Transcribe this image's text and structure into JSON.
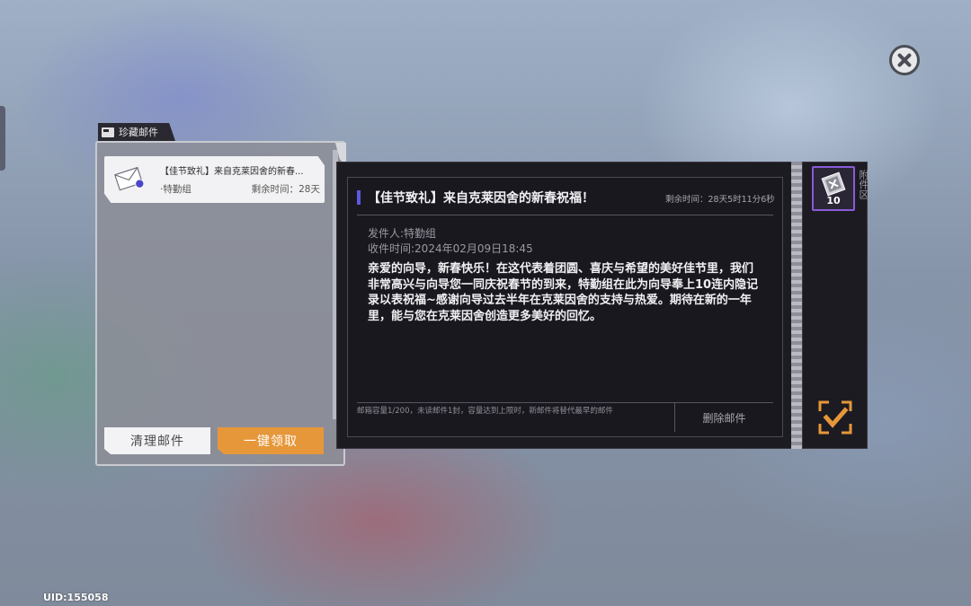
{
  "list": {
    "tab_label": "珍藏邮件",
    "mail_items": [
      {
        "title": "【佳节致礼】来自克莱因舍的新春...",
        "sender": "·特勤组",
        "remaining": "剩余时间：28天"
      }
    ],
    "clean_button": "清理邮件",
    "claim_all_button": "一键领取"
  },
  "mail": {
    "title": "【佳节致礼】来自克莱因舍的新春祝福！",
    "remaining": "剩余时间：28天5时11分6秒",
    "sender": "发件人:特勤组",
    "received": "收件时间:2024年02月09日18:45",
    "body": "亲爱的向导，新春快乐！在这代表着团圆、喜庆与希望的美好佳节里，我们非常高兴与向导您一同庆祝春节的到来，特勤组在此为向导奉上10连内隐记录以表祝福~感谢向导过去半年在克莱因舍的支持与热爱。期待在新的一年里，能与您在克莱因舍创造更多美好的回忆。",
    "capacity_note": "邮箱容量1/200，未读邮件1封，容量达到上限时，新邮件将替代最早的邮件",
    "delete_button": "删除邮件"
  },
  "attachments": {
    "label": "附件区",
    "items": [
      {
        "icon": "ticket-icon",
        "qty": "10"
      }
    ]
  },
  "uid": "UID:155058",
  "colors": {
    "accent_orange": "#e6973a",
    "title_bar_blue": "#5a5ae0",
    "attachment_border": "#8a5bd8"
  }
}
